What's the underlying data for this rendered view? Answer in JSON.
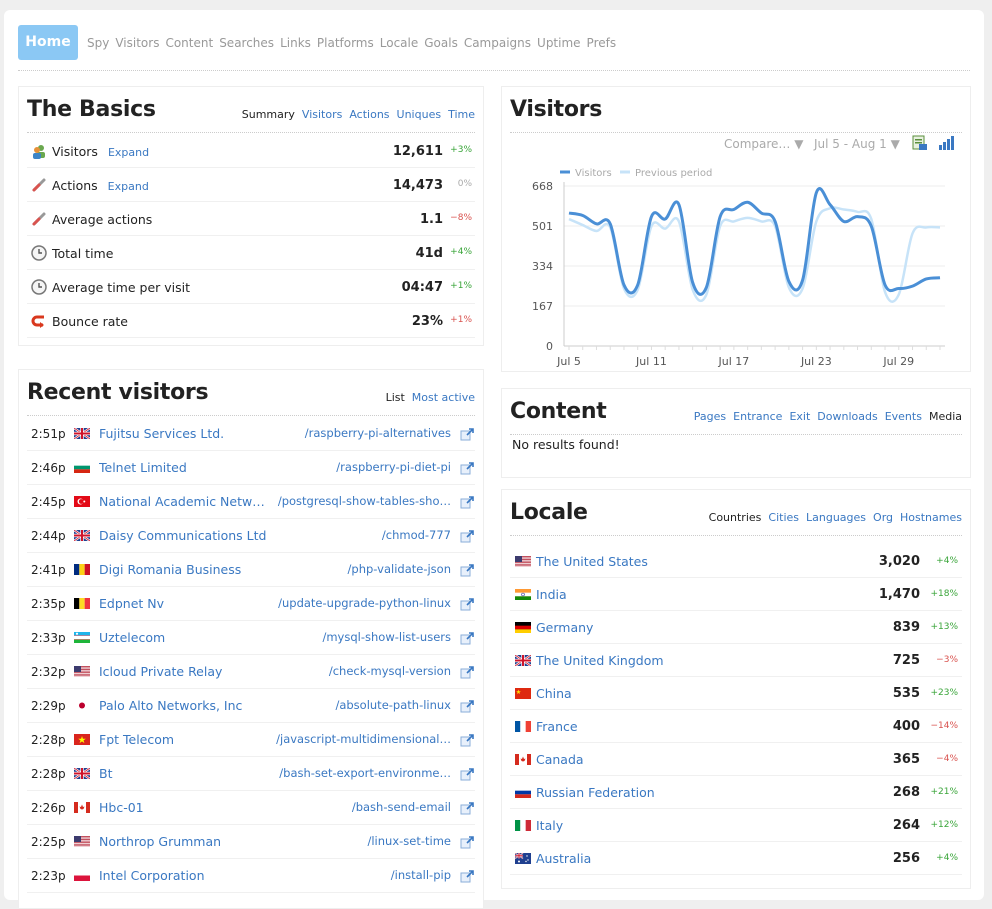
{
  "nav": {
    "home": "Home",
    "links": [
      "Spy",
      "Visitors",
      "Content",
      "Searches",
      "Links",
      "Platforms",
      "Locale",
      "Goals",
      "Campaigns",
      "Uptime",
      "Prefs"
    ]
  },
  "basics": {
    "title": "The Basics",
    "tabs": [
      {
        "label": "Summary",
        "active": true
      },
      {
        "label": "Visitors",
        "active": false
      },
      {
        "label": "Actions",
        "active": false
      },
      {
        "label": "Uniques",
        "active": false
      },
      {
        "label": "Time",
        "active": false
      }
    ],
    "rows": [
      {
        "icon": "visitors-icon",
        "label": "Visitors",
        "expand": "Expand",
        "value": "12,611",
        "change": "+3%",
        "dir": "up"
      },
      {
        "icon": "actions-icon",
        "label": "Actions",
        "expand": "Expand",
        "value": "14,473",
        "change": "0%",
        "dir": "flat"
      },
      {
        "icon": "actions-icon",
        "label": "Average actions",
        "expand": "",
        "value": "1.1",
        "change": "−8%",
        "dir": "dn"
      },
      {
        "icon": "clock-icon",
        "label": "Total time",
        "expand": "",
        "value": "41d",
        "change": "+4%",
        "dir": "up"
      },
      {
        "icon": "clock-icon",
        "label": "Average time per visit",
        "expand": "",
        "value": "04:47",
        "change": "+1%",
        "dir": "up"
      },
      {
        "icon": "bounce-icon",
        "label": "Bounce rate",
        "expand": "",
        "value": "23%",
        "change": "+1%",
        "dir": "dn"
      }
    ]
  },
  "recent": {
    "title": "Recent visitors",
    "tabs": [
      {
        "label": "List",
        "active": true
      },
      {
        "label": "Most active",
        "active": false
      }
    ],
    "rows": [
      {
        "time": "2:51p",
        "flag": "gb",
        "org": "Fujitsu Services Ltd.",
        "path": "/raspberry-pi-alternatives"
      },
      {
        "time": "2:46p",
        "flag": "bg",
        "org": "Telnet Limited",
        "path": "/raspberry-pi-diet-pi"
      },
      {
        "time": "2:45p",
        "flag": "tr",
        "org": "National Academic Networ…",
        "path": "/postgresql-show-tables-sho…"
      },
      {
        "time": "2:44p",
        "flag": "gb",
        "org": "Daisy Communications Ltd",
        "path": "/chmod-777"
      },
      {
        "time": "2:41p",
        "flag": "ro",
        "org": "Digi Romania Business",
        "path": "/php-validate-json"
      },
      {
        "time": "2:35p",
        "flag": "be",
        "org": "Edpnet Nv",
        "path": "/update-upgrade-python-linux"
      },
      {
        "time": "2:33p",
        "flag": "uz",
        "org": "Uztelecom",
        "path": "/mysql-show-list-users"
      },
      {
        "time": "2:32p",
        "flag": "us",
        "org": "Icloud Private Relay",
        "path": "/check-mysql-version"
      },
      {
        "time": "2:29p",
        "flag": "jp",
        "org": "Palo Alto Networks, Inc",
        "path": "/absolute-path-linux"
      },
      {
        "time": "2:28p",
        "flag": "vn",
        "org": "Fpt Telecom",
        "path": "/javascript-multidimensional…"
      },
      {
        "time": "2:28p",
        "flag": "gb",
        "org": "Bt",
        "path": "/bash-set-export-environme…"
      },
      {
        "time": "2:26p",
        "flag": "ca",
        "org": "Hbc-01",
        "path": "/bash-send-email"
      },
      {
        "time": "2:25p",
        "flag": "us",
        "org": "Northrop Grumman",
        "path": "/linux-set-time"
      },
      {
        "time": "2:23p",
        "flag": "pl",
        "org": "Intel Corporation",
        "path": "/install-pip"
      }
    ]
  },
  "visitors_chart": {
    "title": "Visitors",
    "compare": "Compare… ▼",
    "range": "Jul 5 - Aug 1 ▼",
    "chart_data": {
      "type": "line",
      "x": [
        "Jul 5",
        "Jul 6",
        "Jul 7",
        "Jul 8",
        "Jul 9",
        "Jul 10",
        "Jul 11",
        "Jul 12",
        "Jul 13",
        "Jul 14",
        "Jul 15",
        "Jul 16",
        "Jul 17",
        "Jul 18",
        "Jul 19",
        "Jul 20",
        "Jul 21",
        "Jul 22",
        "Jul 23",
        "Jul 24",
        "Jul 25",
        "Jul 26",
        "Jul 27",
        "Jul 28",
        "Jul 29",
        "Jul 30",
        "Jul 31",
        "Aug 1"
      ],
      "xticks": [
        "Jul 5",
        "Jul 11",
        "Jul 17",
        "Jul 23",
        "Jul 29"
      ],
      "yticks": [
        "668",
        "501",
        "334",
        "167",
        "0"
      ],
      "ylim": [
        0,
        668
      ],
      "series": [
        {
          "name": "Visitors",
          "color": "#4a8fd6",
          "values": [
            555,
            545,
            510,
            510,
            255,
            255,
            540,
            530,
            590,
            265,
            245,
            540,
            570,
            600,
            555,
            520,
            270,
            275,
            640,
            590,
            520,
            540,
            500,
            255,
            240,
            250,
            280,
            285
          ]
        },
        {
          "name": "Previous period",
          "color": "#c7e3f8",
          "values": [
            530,
            505,
            480,
            495,
            240,
            235,
            500,
            490,
            520,
            235,
            215,
            500,
            520,
            535,
            520,
            500,
            245,
            240,
            520,
            575,
            570,
            560,
            530,
            225,
            215,
            470,
            495,
            495
          ]
        }
      ]
    }
  },
  "content": {
    "title": "Content",
    "tabs": [
      {
        "label": "Pages",
        "active": false
      },
      {
        "label": "Entrance",
        "active": false
      },
      {
        "label": "Exit",
        "active": false
      },
      {
        "label": "Downloads",
        "active": false
      },
      {
        "label": "Events",
        "active": false
      },
      {
        "label": "Media",
        "active": true
      }
    ],
    "empty": "No results found!"
  },
  "locale": {
    "title": "Locale",
    "tabs": [
      {
        "label": "Countries",
        "active": true
      },
      {
        "label": "Cities",
        "active": false
      },
      {
        "label": "Languages",
        "active": false
      },
      {
        "label": "Org",
        "active": false
      },
      {
        "label": "Hostnames",
        "active": false
      }
    ],
    "rows": [
      {
        "flag": "us",
        "name": "The United States",
        "value": "3,020",
        "change": "+4%",
        "dir": "up"
      },
      {
        "flag": "in",
        "name": "India",
        "value": "1,470",
        "change": "+18%",
        "dir": "up"
      },
      {
        "flag": "de",
        "name": "Germany",
        "value": "839",
        "change": "+13%",
        "dir": "up"
      },
      {
        "flag": "gb",
        "name": "The United Kingdom",
        "value": "725",
        "change": "−3%",
        "dir": "dn"
      },
      {
        "flag": "cn",
        "name": "China",
        "value": "535",
        "change": "+23%",
        "dir": "up"
      },
      {
        "flag": "fr",
        "name": "France",
        "value": "400",
        "change": "−14%",
        "dir": "dn"
      },
      {
        "flag": "ca",
        "name": "Canada",
        "value": "365",
        "change": "−4%",
        "dir": "dn"
      },
      {
        "flag": "ru",
        "name": "Russian Federation",
        "value": "268",
        "change": "+21%",
        "dir": "up"
      },
      {
        "flag": "it",
        "name": "Italy",
        "value": "264",
        "change": "+12%",
        "dir": "up"
      },
      {
        "flag": "au",
        "name": "Australia",
        "value": "256",
        "change": "+4%",
        "dir": "up"
      }
    ]
  }
}
